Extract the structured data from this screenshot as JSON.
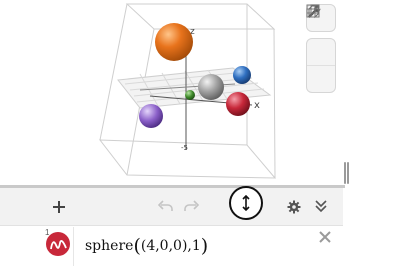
{
  "graphics_view": {
    "axis_labels": {
      "z": "z",
      "x": "x",
      "z_tick_min": "-5"
    },
    "spheres": [
      {
        "name": "orange",
        "color": "#e8731c"
      },
      {
        "name": "gray",
        "color": "#9c9c9c"
      },
      {
        "name": "blue",
        "color": "#2f6fc0"
      },
      {
        "name": "red",
        "color": "#c8283a"
      },
      {
        "name": "green",
        "color": "#3e8a2a"
      },
      {
        "name": "purple",
        "color": "#8a5fc8"
      }
    ]
  },
  "side_tools": {
    "icons": [
      "wrench-icon",
      "cube-icon",
      "grid-icon"
    ]
  },
  "toolbar": {
    "icons": [
      "plus-icon",
      "undo-icon",
      "redo-icon",
      "resize-handle-icon",
      "gear-icon",
      "double-chevron-down-icon"
    ]
  },
  "algebra": {
    "row_number": "1",
    "command": "sphere",
    "open_paren": "(",
    "args": "(4,0,0),1",
    "close_paren": ")",
    "marker_color": "#c8283a"
  }
}
